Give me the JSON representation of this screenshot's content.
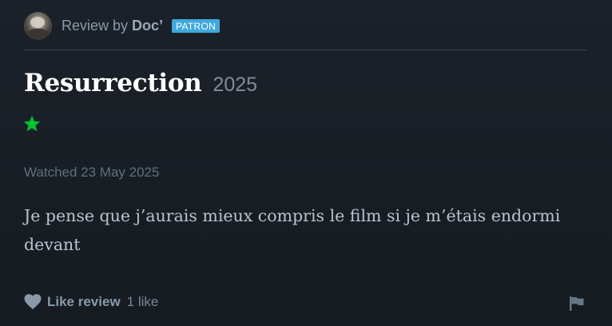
{
  "header": {
    "review_by_label": "Review by",
    "author": "Doc’",
    "badge": "PATRON"
  },
  "film": {
    "title": "Resurrection",
    "year": "2025"
  },
  "rating": {
    "stars": 1,
    "max": 5,
    "star_color": "#00c030"
  },
  "watched": "Watched 23 May 2025",
  "review": {
    "text": "Je pense que j’aurais mieux compris le film si je m’étais endormi devant"
  },
  "actions": {
    "like_label": "Like review",
    "like_count": "1 like",
    "like_icon": "heart-icon",
    "report_icon": "flag-icon"
  },
  "colors": {
    "background": "#1b2129",
    "badge": "#3fa9dd",
    "title": "#ffffff"
  }
}
